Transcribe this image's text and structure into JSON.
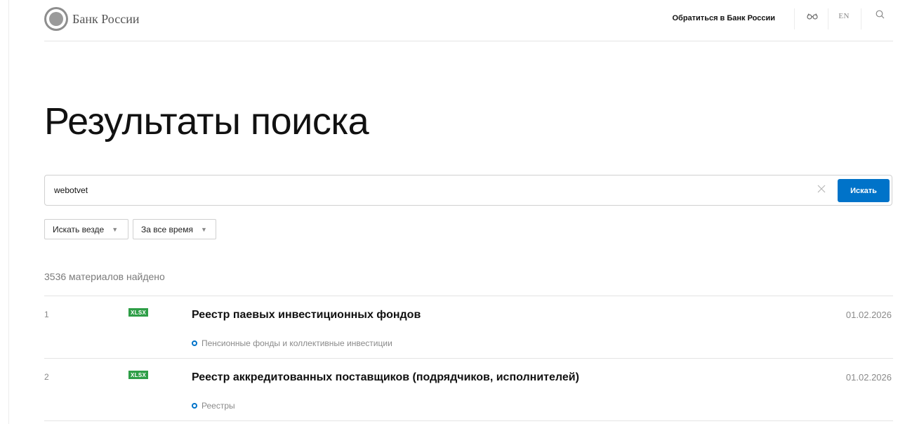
{
  "header": {
    "logo_text": "Банк России",
    "contact_link": "Обратиться в Банк России",
    "vision_icon": "glasses-icon",
    "lang_label": "EN",
    "search_icon": "search-icon"
  },
  "page_title": "Результаты поиска",
  "search": {
    "value": "webotvet",
    "placeholder": "",
    "clear_icon": "close-icon",
    "button_label": "Искать"
  },
  "filters": {
    "where": {
      "label": "Искать везде",
      "arrow": "▼"
    },
    "time": {
      "label": "За все время",
      "arrow": "▼"
    }
  },
  "results": {
    "count_label": "3536 материалов найдено",
    "items": [
      {
        "number": "1",
        "badge": "XLSX",
        "title": "Реестр паевых инвестиционных фондов",
        "category": "Пенсионные фонды и коллективные инвестиции",
        "date": "01.02.2026"
      },
      {
        "number": "2",
        "badge": "XLSX",
        "title": "Реестр аккредитованных поставщиков (подрядчиков, исполнителей)",
        "category": "Реестры",
        "date": "01.02.2026"
      }
    ]
  },
  "colors": {
    "accent": "#0073c9",
    "badge": "#2e9e47"
  }
}
